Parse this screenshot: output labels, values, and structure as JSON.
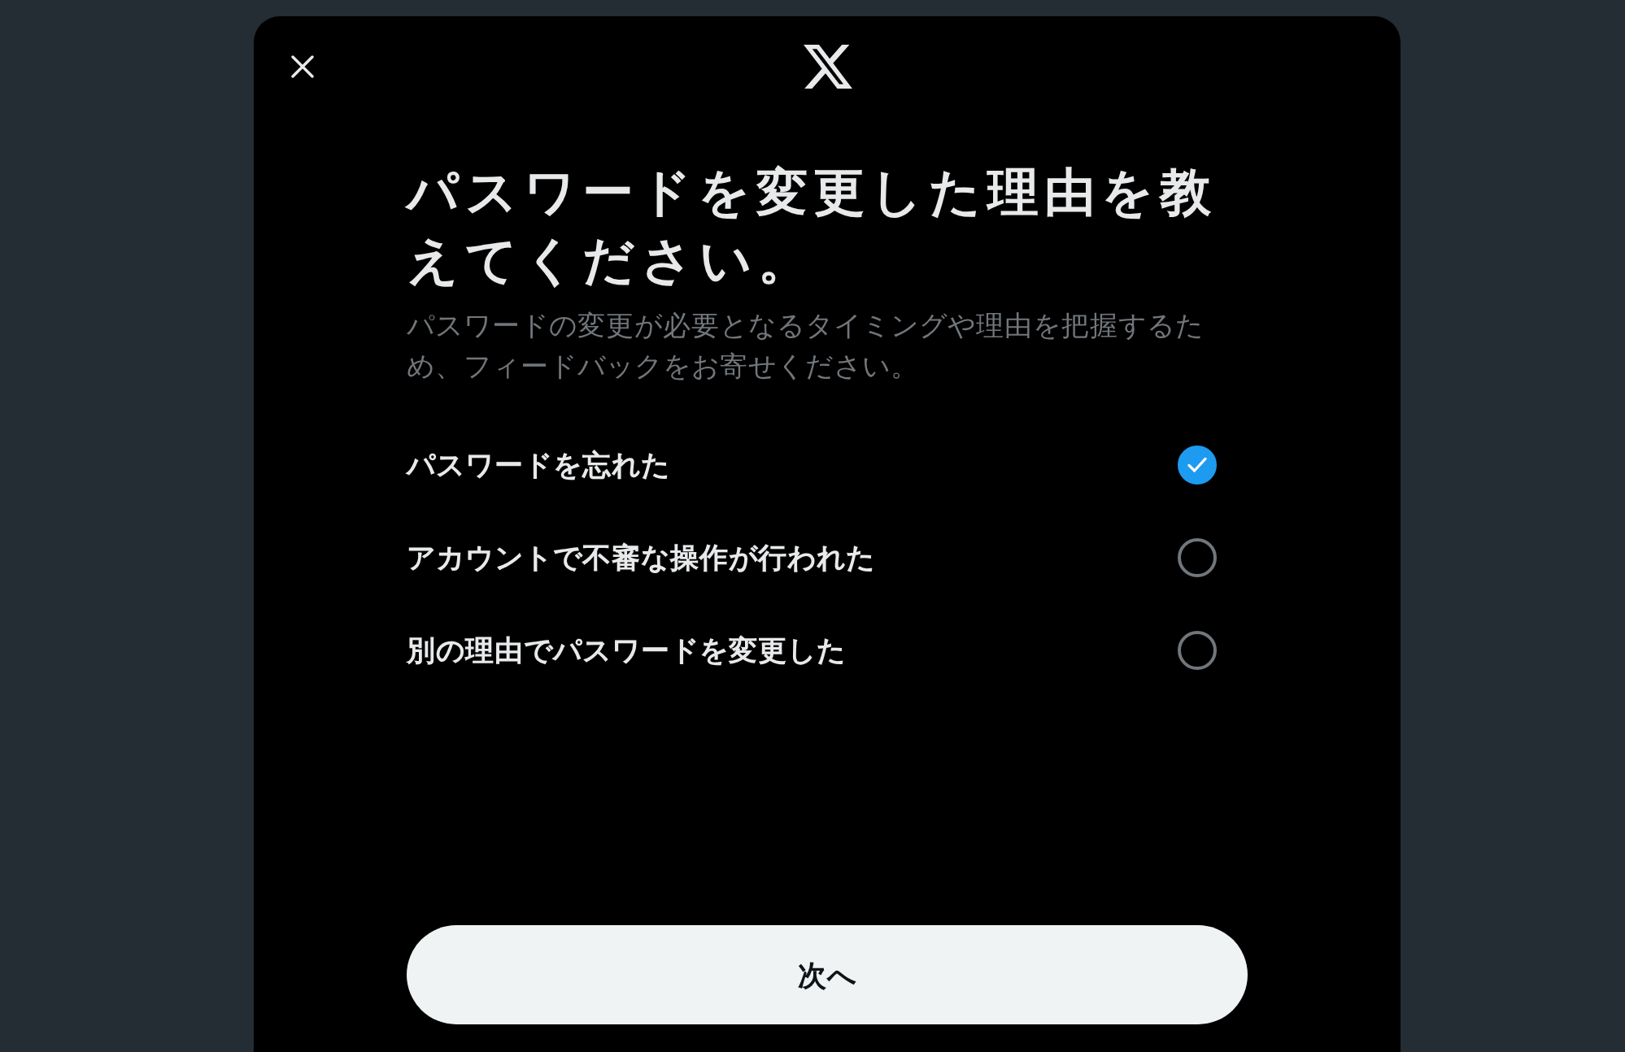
{
  "dialog": {
    "title": "パスワードを変更した理由を教えてください。",
    "description": "パスワードの変更が必要となるタイミングや理由を把握するため、フィードバックをお寄せください。",
    "options": [
      {
        "label": "パスワードを忘れた",
        "selected": true
      },
      {
        "label": "アカウントで不審な操作が行われた",
        "selected": false
      },
      {
        "label": "別の理由でパスワードを変更した",
        "selected": false
      }
    ],
    "next_button": {
      "label": "次へ"
    }
  }
}
